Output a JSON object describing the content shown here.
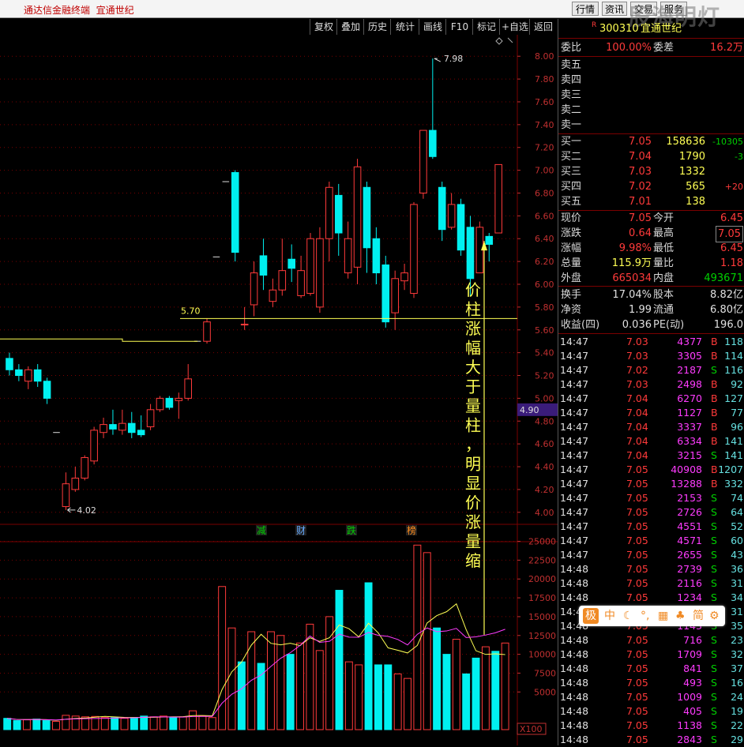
{
  "titlebar": {
    "app": "通达信金融终端",
    "stock": "宜通世纪",
    "buttons": [
      "行情",
      "资讯",
      "交易",
      "服务"
    ],
    "watermark": "股海明灯"
  },
  "toolbar": [
    "复权",
    "叠加",
    "历史",
    "统计",
    "画线",
    "F10",
    "标记",
    "+自选",
    "返回"
  ],
  "colors": {
    "up": "#ff3a3a",
    "down": "#00f0f0",
    "ma_line": "#ffff54",
    "vol_ma1": "#ffff54",
    "vol_ma2": "#ff3cff",
    "grid": "#7a0000"
  },
  "chart_data": [
    {
      "type": "candlestick",
      "title": "",
      "price_axis": {
        "ticks": [
          "8.00",
          "7.80",
          "7.60",
          "7.40",
          "7.20",
          "7.00",
          "6.80",
          "6.60",
          "6.40",
          "6.20",
          "6.00",
          "5.80",
          "5.60",
          "5.40",
          "5.20",
          "5.00",
          "4.80",
          "4.60",
          "4.40",
          "4.20",
          "4.00"
        ],
        "min": 3.95,
        "max": 8.05
      },
      "current_price_label": "4.90",
      "annotations": {
        "high": "7.98",
        "low": "4.02",
        "support": "5.70",
        "note": "价柱涨幅大于量柱，明显价涨量缩",
        "events": [
          "减",
          "财",
          "跌",
          "榜"
        ]
      },
      "candles": [
        {
          "o": 5.35,
          "c": 5.25,
          "h": 5.4,
          "l": 5.2
        },
        {
          "o": 5.25,
          "c": 5.2,
          "h": 5.3,
          "l": 5.15
        },
        {
          "o": 5.15,
          "c": 5.25,
          "h": 5.28,
          "l": 5.08
        },
        {
          "o": 5.25,
          "c": 5.15,
          "h": 5.3,
          "l": 5.1
        },
        {
          "o": 5.15,
          "c": 5.0,
          "h": 5.18,
          "l": 4.95
        },
        {
          "o": 4.7,
          "c": 4.7,
          "h": 4.7,
          "l": 4.7
        },
        {
          "o": 4.05,
          "c": 4.25,
          "h": 4.35,
          "l": 4.02
        },
        {
          "o": 4.2,
          "c": 4.3,
          "h": 4.4,
          "l": 4.18
        },
        {
          "o": 4.3,
          "c": 4.48,
          "h": 4.5,
          "l": 4.28
        },
        {
          "o": 4.45,
          "c": 4.72,
          "h": 4.75,
          "l": 4.42
        },
        {
          "o": 4.7,
          "c": 4.77,
          "h": 4.83,
          "l": 4.65
        },
        {
          "o": 4.77,
          "c": 4.73,
          "h": 4.9,
          "l": 4.68
        },
        {
          "o": 4.72,
          "c": 4.78,
          "h": 4.9,
          "l": 4.68
        },
        {
          "o": 4.78,
          "c": 4.7,
          "h": 4.88,
          "l": 4.65
        },
        {
          "o": 4.72,
          "c": 4.68,
          "h": 4.85,
          "l": 4.66
        },
        {
          "o": 4.75,
          "c": 4.9,
          "h": 4.95,
          "l": 4.72
        },
        {
          "o": 4.9,
          "c": 5.0,
          "h": 5.02,
          "l": 4.88
        },
        {
          "o": 5.0,
          "c": 4.92,
          "h": 5.02,
          "l": 4.9
        },
        {
          "o": 4.98,
          "c": 5.0,
          "h": 5.05,
          "l": 4.82
        },
        {
          "o": 5.0,
          "c": 5.17,
          "h": 5.3,
          "l": 4.98
        },
        {
          "o": 5.5,
          "c": 5.5,
          "h": 5.5,
          "l": 5.5
        },
        {
          "o": 5.5,
          "c": 5.67,
          "h": 5.7,
          "l": 5.48
        },
        {
          "o": 6.24,
          "c": 6.24,
          "h": 6.24,
          "l": 6.24
        },
        {
          "o": 6.9,
          "c": 6.9,
          "h": 6.9,
          "l": 6.9
        },
        {
          "o": 6.98,
          "c": 6.28,
          "h": 7.0,
          "l": 6.2
        },
        {
          "o": 5.65,
          "c": 5.65,
          "h": 5.8,
          "l": 5.6
        },
        {
          "o": 5.82,
          "c": 6.1,
          "h": 6.2,
          "l": 5.72
        },
        {
          "o": 6.25,
          "c": 6.08,
          "h": 6.4,
          "l": 5.95
        },
        {
          "o": 5.85,
          "c": 5.95,
          "h": 6.05,
          "l": 5.8
        },
        {
          "o": 5.95,
          "c": 6.12,
          "h": 6.4,
          "l": 5.9
        },
        {
          "o": 6.22,
          "c": 6.14,
          "h": 6.35,
          "l": 6.02
        },
        {
          "o": 5.9,
          "c": 6.12,
          "h": 6.25,
          "l": 5.88
        },
        {
          "o": 5.92,
          "c": 6.4,
          "h": 6.45,
          "l": 5.9
        },
        {
          "o": 5.8,
          "c": 6.4,
          "h": 6.5,
          "l": 5.75
        },
        {
          "o": 6.4,
          "c": 6.85,
          "h": 6.9,
          "l": 6.2
        },
        {
          "o": 6.78,
          "c": 6.45,
          "h": 6.88,
          "l": 6.25
        },
        {
          "o": 6.1,
          "c": 6.4,
          "h": 6.55,
          "l": 6.05
        },
        {
          "o": 6.15,
          "c": 7.03,
          "h": 7.1,
          "l": 6.0
        },
        {
          "o": 6.85,
          "c": 6.32,
          "h": 6.9,
          "l": 6.1
        },
        {
          "o": 6.4,
          "c": 6.1,
          "h": 6.5,
          "l": 6.0
        },
        {
          "o": 6.17,
          "c": 5.67,
          "h": 6.25,
          "l": 5.62
        },
        {
          "o": 5.75,
          "c": 6.05,
          "h": 6.12,
          "l": 5.6
        },
        {
          "o": 6.03,
          "c": 6.1,
          "h": 6.18,
          "l": 5.95
        },
        {
          "o": 5.92,
          "c": 6.7,
          "h": 6.72,
          "l": 5.88
        },
        {
          "o": 6.8,
          "c": 7.35,
          "h": 7.35,
          "l": 6.75
        },
        {
          "o": 7.35,
          "c": 7.12,
          "h": 7.98,
          "l": 7.1
        },
        {
          "o": 6.85,
          "c": 6.48,
          "h": 6.9,
          "l": 6.38
        },
        {
          "o": 6.5,
          "c": 6.7,
          "h": 6.8,
          "l": 6.48
        },
        {
          "o": 6.7,
          "c": 6.3,
          "h": 6.75,
          "l": 6.25
        },
        {
          "o": 6.5,
          "c": 6.05,
          "h": 6.6,
          "l": 5.9
        },
        {
          "o": 6.1,
          "c": 6.5,
          "h": 6.55,
          "l": 6.1
        },
        {
          "o": 6.42,
          "c": 6.35,
          "h": 6.45,
          "l": 6.2
        },
        {
          "o": 6.45,
          "c": 7.05,
          "h": 7.05,
          "l": 6.45
        }
      ]
    },
    {
      "type": "bar",
      "title": "",
      "volume_axis": {
        "ticks": [
          "25000",
          "22500",
          "20000",
          "17500",
          "15000",
          "12500",
          "10000",
          "7500",
          "5000"
        ],
        "min": 0,
        "max": 26000,
        "unit": "X100"
      },
      "volumes": [
        1500,
        1200,
        1300,
        1400,
        1200,
        1100,
        1900,
        1800,
        1700,
        1750,
        1600,
        1600,
        1500,
        1600,
        1800,
        1700,
        1800,
        1600,
        1700,
        2500,
        1800,
        1600,
        19000,
        13500,
        9000,
        13000,
        8800,
        13000,
        12500,
        10000,
        11500,
        14000,
        10500,
        15000,
        18500,
        9000,
        8600,
        19500,
        8600,
        8600,
        7400,
        6800,
        24500,
        23500,
        13500,
        10000,
        12000,
        7400,
        9500,
        11000,
        10400,
        11500
      ]
    }
  ],
  "panel": {
    "code": "300310",
    "name": "宜通世纪",
    "mark": "R",
    "weibi": {
      "label": "委比",
      "value": "100.00%",
      "label2": "委差",
      "value2": "16.2万"
    },
    "sell": [
      {
        "label": "卖五"
      },
      {
        "label": "卖四"
      },
      {
        "label": "卖三"
      },
      {
        "label": "卖二"
      },
      {
        "label": "卖一"
      }
    ],
    "buy": [
      {
        "label": "买一",
        "price": "7.05",
        "vol": "158636",
        "chg": "-10305"
      },
      {
        "label": "买二",
        "price": "7.04",
        "vol": "1790",
        "chg": "-3"
      },
      {
        "label": "买三",
        "price": "7.03",
        "vol": "1332",
        "chg": ""
      },
      {
        "label": "买四",
        "price": "7.02",
        "vol": "565",
        "chg": "+20"
      },
      {
        "label": "买五",
        "price": "7.01",
        "vol": "138",
        "chg": ""
      }
    ],
    "quote": [
      {
        "l1": "现价",
        "v1": "7.05",
        "l2": "今开",
        "v2": "6.45"
      },
      {
        "l1": "涨跌",
        "v1": "0.64",
        "l2": "最高",
        "v2": "7.05"
      },
      {
        "l1": "涨幅",
        "v1": "9.98%",
        "l2": "最低",
        "v2": "6.45"
      },
      {
        "l1": "总量",
        "v1": "115.9万",
        "l2": "量比",
        "v2": "1.18"
      },
      {
        "l1": "外盘",
        "v1": "665034",
        "l2": "内盘",
        "v2": "493671"
      }
    ],
    "fund": [
      {
        "l1": "换手",
        "v1": "17.04%",
        "l2": "股本",
        "v2": "8.82亿"
      },
      {
        "l1": "净资",
        "v1": "1.99",
        "l2": "流通",
        "v2": "6.80亿"
      },
      {
        "l1": "收益(四)",
        "v1": "0.036",
        "l2": "PE(动)",
        "v2": "196.0"
      }
    ],
    "ticks": [
      [
        "14:47",
        "7.03",
        "4377",
        "B",
        "118"
      ],
      [
        "14:47",
        "7.03",
        "3305",
        "B",
        "114"
      ],
      [
        "14:47",
        "7.02",
        "2187",
        "S",
        "116"
      ],
      [
        "14:47",
        "7.03",
        "2498",
        "B",
        "92"
      ],
      [
        "14:47",
        "7.04",
        "6270",
        "B",
        "127"
      ],
      [
        "14:47",
        "7.04",
        "1127",
        "B",
        "77"
      ],
      [
        "14:47",
        "7.04",
        "3337",
        "B",
        "96"
      ],
      [
        "14:47",
        "7.04",
        "6334",
        "B",
        "141"
      ],
      [
        "14:47",
        "7.04",
        "3215",
        "S",
        "141"
      ],
      [
        "14:47",
        "7.05",
        "40908",
        "B",
        "1207"
      ],
      [
        "14:47",
        "7.05",
        "13288",
        "B",
        "332"
      ],
      [
        "14:47",
        "7.05",
        "2153",
        "S",
        "74"
      ],
      [
        "14:47",
        "7.05",
        "2726",
        "S",
        "64"
      ],
      [
        "14:47",
        "7.05",
        "4551",
        "S",
        "52"
      ],
      [
        "14:47",
        "7.05",
        "4571",
        "S",
        "60"
      ],
      [
        "14:47",
        "7.05",
        "2655",
        "S",
        "43"
      ],
      [
        "14:48",
        "7.05",
        "2739",
        "S",
        "36"
      ],
      [
        "14:48",
        "7.05",
        "2116",
        "S",
        "31"
      ],
      [
        "14:48",
        "7.05",
        "1234",
        "S",
        "34"
      ],
      [
        "14:48",
        "7.05",
        "",
        "S",
        "31"
      ],
      [
        "14:48",
        "7.05",
        "1143",
        "S",
        "35"
      ],
      [
        "14:48",
        "7.05",
        "716",
        "S",
        "23"
      ],
      [
        "14:48",
        "7.05",
        "1709",
        "S",
        "32"
      ],
      [
        "14:48",
        "7.05",
        "841",
        "S",
        "37"
      ],
      [
        "14:48",
        "7.05",
        "493",
        "S",
        "16"
      ],
      [
        "14:48",
        "7.05",
        "1009",
        "S",
        "24"
      ],
      [
        "14:48",
        "7.05",
        "405",
        "S",
        "19"
      ],
      [
        "14:48",
        "7.05",
        "1138",
        "S",
        "22"
      ],
      [
        "14:48",
        "7.05",
        "2843",
        "S",
        "29"
      ]
    ]
  },
  "ime": {
    "items": [
      "极",
      "中",
      "☾",
      "°,",
      "▦",
      "♣",
      "简",
      "⚙"
    ]
  }
}
